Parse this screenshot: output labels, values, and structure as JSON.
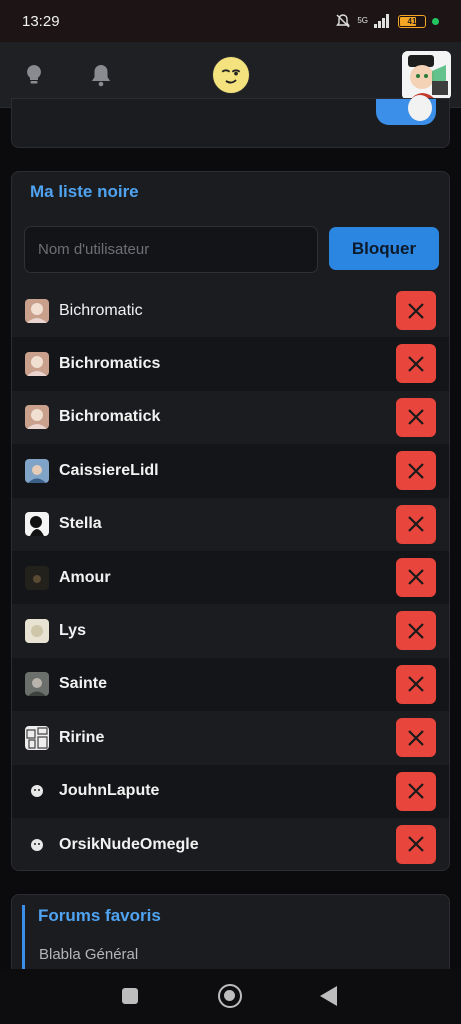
{
  "status": {
    "time": "13:29",
    "network": "5G",
    "battery": "41"
  },
  "blacklist": {
    "title": "Ma liste noire",
    "input_placeholder": "Nom d'utilisateur",
    "block_label": "Bloquer",
    "users": [
      {
        "name": "Bichromatic",
        "avatar": "photo-pink"
      },
      {
        "name": "Bichromatics",
        "avatar": "photo-pink"
      },
      {
        "name": "Bichromatick",
        "avatar": "photo-pink"
      },
      {
        "name": "CaissiereLidl",
        "avatar": "photo-blue"
      },
      {
        "name": "Stella",
        "avatar": "photo-silhouette"
      },
      {
        "name": "Amour",
        "avatar": "photo-dark"
      },
      {
        "name": "Lys",
        "avatar": "photo-cream"
      },
      {
        "name": "Sainte",
        "avatar": "photo-gray"
      },
      {
        "name": "Ririne",
        "avatar": "photo-manga"
      },
      {
        "name": "JouhnLapute",
        "avatar": "default-face"
      },
      {
        "name": "OrsikNudeOmegle",
        "avatar": "default-face"
      }
    ]
  },
  "favorites": {
    "title": "Forums favoris",
    "items": [
      "Blabla Général"
    ]
  },
  "icons": {
    "top_left": "lightbulb-icon",
    "top_second": "bell-icon",
    "delete": "close-icon"
  },
  "colors": {
    "accent": "#4fa3f0",
    "primary_button": "#2b86e2",
    "danger": "#e8453c"
  }
}
